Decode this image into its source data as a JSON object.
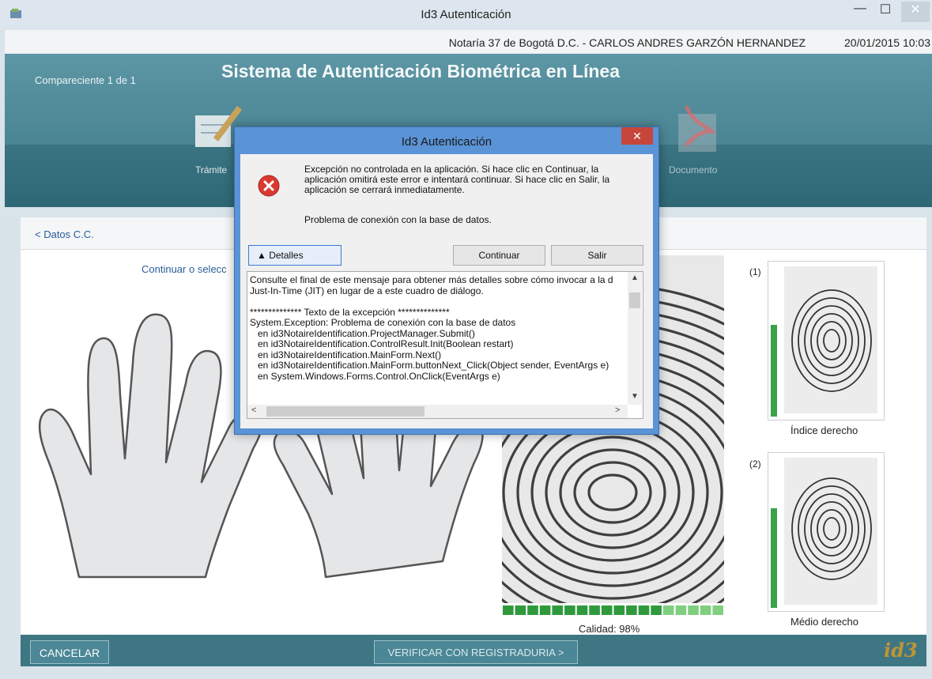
{
  "window": {
    "title": "Id3 Autenticación",
    "minimize": "—",
    "maximize": "☐",
    "close": "✕"
  },
  "infobar": {
    "notaria": "Notaría 37 de Bogotá D.C. - CARLOS ANDRES GARZÓN HERNANDEZ",
    "datetime": "20/01/2015 10:03"
  },
  "header": {
    "compareciente": "Compareciente 1 de 1",
    "title": "Sistema de Autenticación Biométrica en Línea",
    "steps": [
      "Trámite",
      "Documento"
    ]
  },
  "subheader": {
    "back": "< Datos C.C."
  },
  "main": {
    "instruction": "Continuar o selecc",
    "quality": "Calidad: 98%",
    "finger1_num": "(1)",
    "finger1_label": "Índice derecho",
    "finger2_num": "(2)",
    "finger2_label": "Médio derecho"
  },
  "footer": {
    "cancel": "CANCELAR",
    "verify": "VERIFICAR CON REGISTRADURIA >",
    "logo": "id3"
  },
  "dialog": {
    "title": "Id3 Autenticación",
    "close": "✕",
    "message": "Excepción no controlada en la aplicación. Si hace clic en Continuar, la aplicación omitirá este error e intentará continuar. Si hace clic en Salir, la aplicación se cerrará inmediatamente.",
    "problem": "Problema de conexión con la base de datos.",
    "details_button": "▲   Detalles",
    "continue_button": "Continuar",
    "exit_button": "Salir",
    "details_text": "Consulte el final de este mensaje para obtener más detalles sobre cómo invocar a la d\nJust-In-Time (JIT) en lugar de a este cuadro de diálogo.\n\n************** Texto de la excepción **************\nSystem.Exception: Problema de conexión con la base de datos\n   en id3NotaireIdentification.ProjectManager.Submit()\n   en id3NotaireIdentification.ControlResult.Init(Boolean restart)\n   en id3NotaireIdentification.MainForm.Next()\n   en id3NotaireIdentification.MainForm.buttonNext_Click(Object sender, EventArgs e)\n   en System.Windows.Forms.Control.OnClick(EventArgs e)"
  },
  "colors": {
    "accent": "#3e7684",
    "dialog_frame": "#5a93d6",
    "quality_green": "#2e9a3c"
  }
}
